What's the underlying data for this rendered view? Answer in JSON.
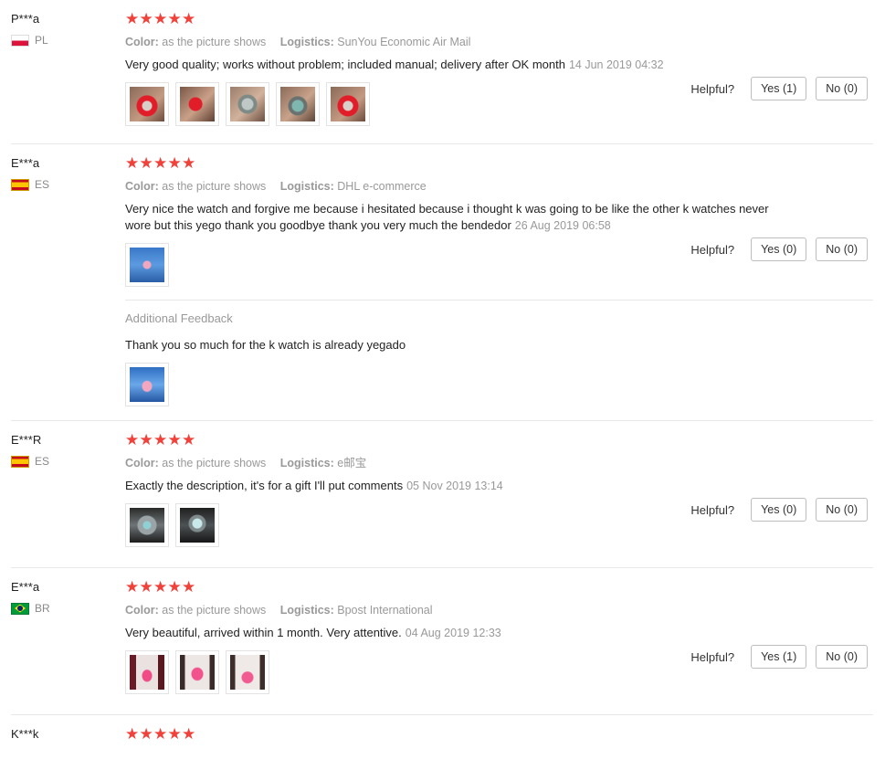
{
  "helpful_label": "Helpful?",
  "color_label": "Color:",
  "logistics_label": "Logistics:",
  "colors": {
    "star": "#f0413b",
    "muted": "#999999"
  },
  "reviews": [
    {
      "user": "P***a",
      "country": "PL",
      "flag_icon": "poland-flag-icon",
      "stars": 5,
      "color": "as the picture shows",
      "logistics": "SunYou Economic Air Mail",
      "text": "Very good quality; works without problem; included manual; delivery after OK month",
      "date": "14 Jun 2019 04:32",
      "photos": 5,
      "yes": "Yes (1)",
      "no": "No (0)"
    },
    {
      "user": "E***a",
      "country": "ES",
      "flag_icon": "spain-flag-icon",
      "stars": 5,
      "color": "as the picture shows",
      "logistics": "DHL e-commerce",
      "text": "Very nice the watch and forgive me because i hesitated because i thought k was going to be like the other k watches never wore but this yego thank you goodbye thank you very much the bendedor",
      "date": "26 Aug 2019 06:58",
      "photos": 1,
      "yes": "Yes (0)",
      "no": "No (0)",
      "additional_title": "Additional Feedback",
      "additional_text": "Thank you so much for the k watch is already yegado",
      "additional_photos": 1
    },
    {
      "user": "E***R",
      "country": "ES",
      "flag_icon": "spain-flag-icon",
      "stars": 5,
      "color": "as the picture shows",
      "logistics": "e邮宝",
      "text": "Exactly the description, it's for a gift I'll put comments",
      "date": "05 Nov 2019 13:14",
      "photos": 2,
      "yes": "Yes (0)",
      "no": "No (0)"
    },
    {
      "user": "E***a",
      "country": "BR",
      "flag_icon": "brazil-flag-icon",
      "stars": 5,
      "color": "as the picture shows",
      "logistics": "Bpost International",
      "text": "Very beautiful, arrived within 1 month. Very attentive.",
      "date": "04 Aug 2019 12:33",
      "photos": 3,
      "yes": "Yes (1)",
      "no": "No (0)"
    },
    {
      "user": "K***k",
      "stars": 5
    }
  ]
}
